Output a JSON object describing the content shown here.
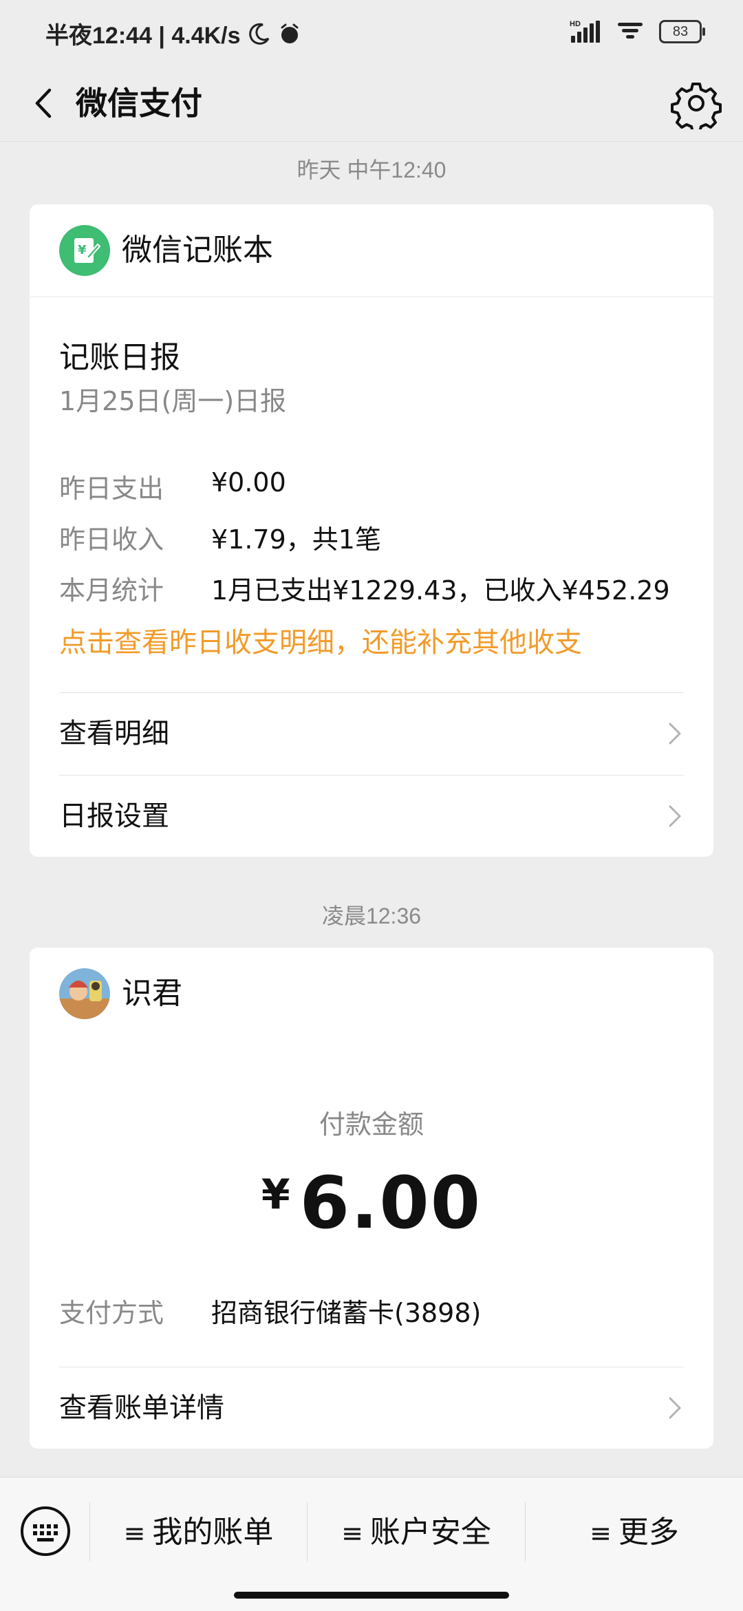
{
  "status_bar": {
    "time_text": "半夜12:44 | 4.4K/s",
    "hd_label": "HD",
    "battery_level": "83"
  },
  "header": {
    "title": "微信支付"
  },
  "messages": [
    {
      "timestamp": "昨天 中午12:40",
      "source_name": "微信记账本",
      "report_title": "记账日报",
      "report_subtitle": "1月25日(周一)日报",
      "rows": [
        {
          "label": "昨日支出",
          "value": "¥0.00"
        },
        {
          "label": "昨日收入",
          "value": "¥1.79，共1笔"
        },
        {
          "label": "本月统计",
          "value": "1月已支出¥1229.43，已收入¥452.29"
        }
      ],
      "highlight_link": "点击查看昨日收支明细，还能补充其他收支",
      "actions": [
        "查看明细",
        "日报设置"
      ]
    },
    {
      "timestamp": "凌晨12:36",
      "payee_name": "识君",
      "amount_label": "付款金额",
      "currency_symbol": "¥",
      "amount": "6.00",
      "method_label": "支付方式",
      "method_value": "招商银行储蓄卡(3898)",
      "action": "查看账单详情"
    }
  ],
  "bottom_menu": {
    "items": [
      "我的账单",
      "账户安全",
      "更多"
    ],
    "menu_glyph": "≡"
  },
  "colors": {
    "accent_orange": "#f29b2a",
    "ledger_green": "#3ebd73",
    "background": "#ededed"
  }
}
